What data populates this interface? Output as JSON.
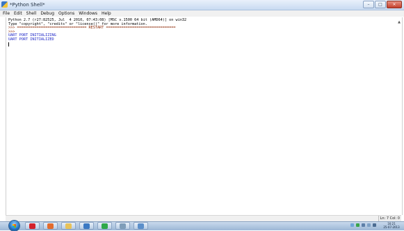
{
  "window": {
    "title": "*Python Shell*",
    "controls": {
      "minimize": "–",
      "maximize": "□",
      "close": "×"
    }
  },
  "menu": {
    "items": [
      "File",
      "Edit",
      "Shell",
      "Debug",
      "Options",
      "Windows",
      "Help"
    ]
  },
  "shell": {
    "lines": [
      {
        "type": "banner",
        "text": "Python 2.7 (r27:82525, Jul  4 2010, 07:43:08) [MSC v.1500 64 bit (AMD64)] on win32"
      },
      {
        "type": "banner",
        "text": "Type \"copyright\", \"credits\" or \"license()\" for more information."
      },
      {
        "type": "prompt",
        "text": ">>> ================================ RESTART ================================"
      },
      {
        "type": "prompt",
        "text": ">>> "
      },
      {
        "type": "output",
        "text": "UART PORT INITIALIZING"
      },
      {
        "type": "output",
        "text": "UART PORT INITIALIZED"
      }
    ]
  },
  "statusbar": {
    "position": "Ln: 7 Col: 0"
  },
  "taskbar": {
    "apps": [
      {
        "icon": "opera-icon",
        "color": "#d3212c"
      },
      {
        "icon": "media-player-icon",
        "color": "#e26c2e"
      },
      {
        "icon": "folder-icon",
        "color": "#e7c25a"
      },
      {
        "icon": "python-icon",
        "color": "#3b79c3"
      },
      {
        "icon": "chrome-icon",
        "color": "#2ea84a"
      },
      {
        "icon": "paint-icon",
        "color": "#7f9db9"
      },
      {
        "icon": "idle-icon",
        "color": "#5c8fca"
      }
    ],
    "clock_time": "16:21",
    "clock_date": "25-07-2013"
  }
}
